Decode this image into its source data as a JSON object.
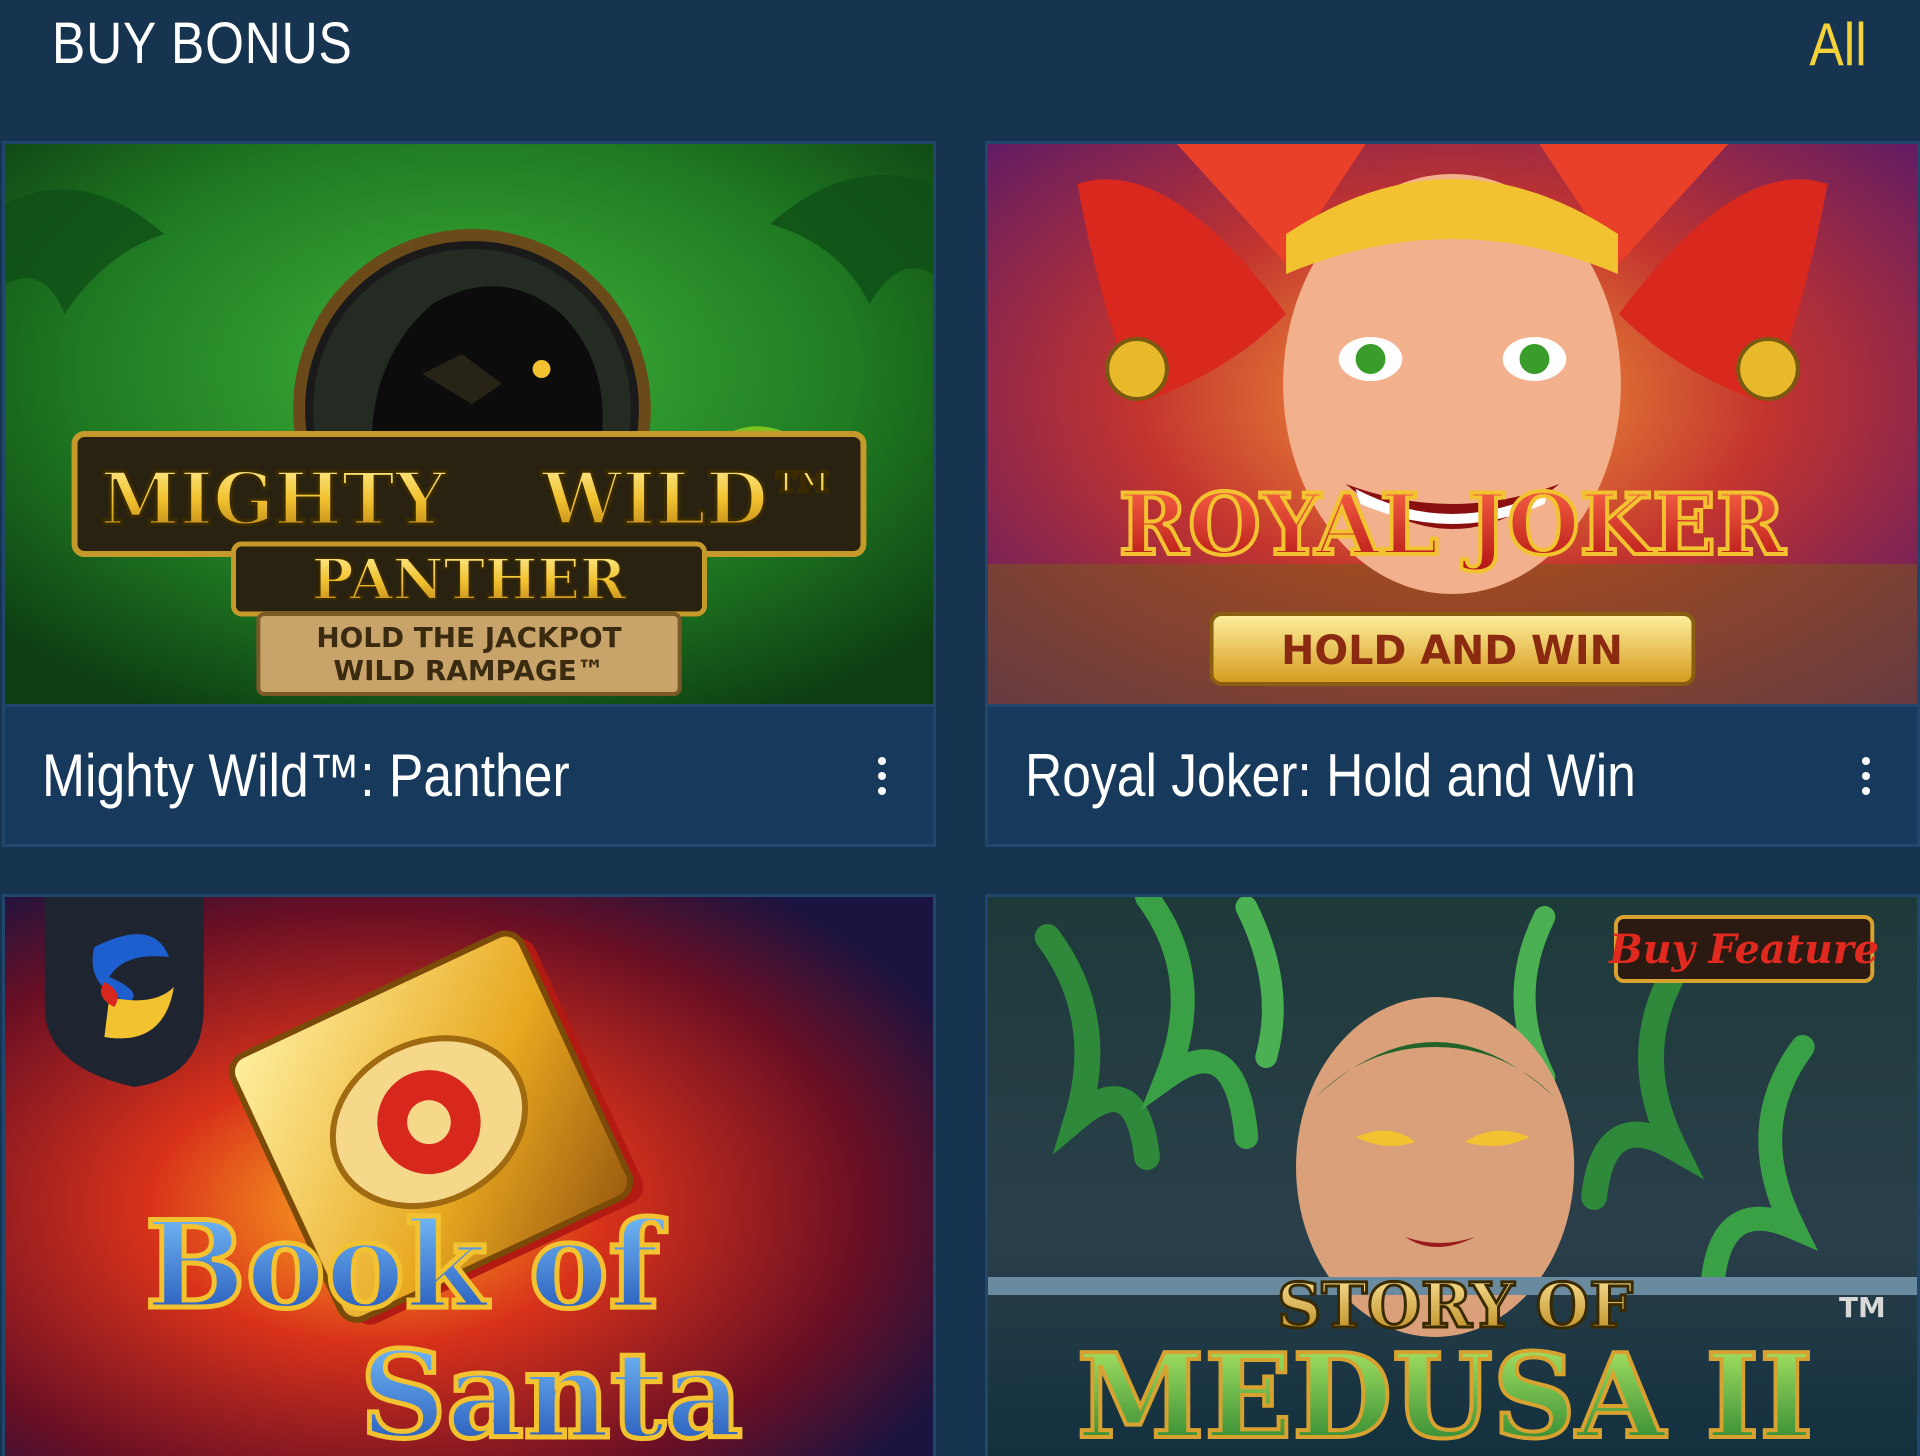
{
  "header": {
    "title": "BUY BONUS",
    "all_label": "All"
  },
  "games": [
    {
      "name": "Mighty Wild™: Panther",
      "art_title_line1": "MIGHTY",
      "art_title_line1b": "WILD™",
      "art_title_line2": "PANTHER",
      "art_subtitle_line1": "HOLD THE JACKPOT",
      "art_subtitle_line2": "WILD RAMPAGE™",
      "menu_icon": "kebab-menu-icon"
    },
    {
      "name": "Royal Joker: Hold and Win",
      "art_title_line1": "ROYAL JOKER",
      "art_subtitle_line1": "HOLD AND WIN",
      "menu_icon": "kebab-menu-icon"
    },
    {
      "art_title_line1": "Book of",
      "art_title_line2": "Santa",
      "provider_icon": "provider-logo-icon"
    },
    {
      "art_badge": "Buy Feature",
      "art_title_line1": "STORY OF",
      "art_title_line2": "MEDUSA II",
      "art_tm": "TM"
    }
  ],
  "colors": {
    "background": "#16344f",
    "card": "#173a5c",
    "card_border": "#21466b",
    "accent": "#f3d23a",
    "text": "#ffffff"
  }
}
